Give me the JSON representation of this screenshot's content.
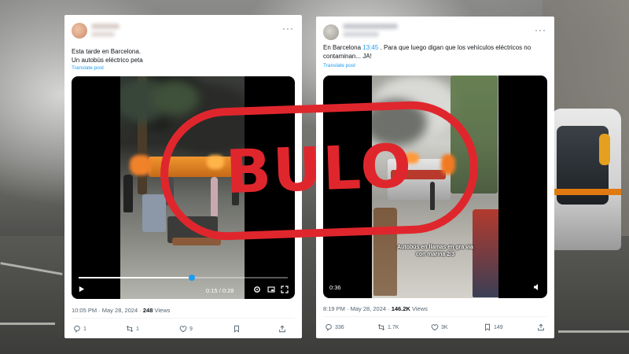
{
  "posts": [
    {
      "text": "Esta tarde en Barcelona.\nUn autobús eléctrico peta",
      "translate_label": "Translate post",
      "video": {
        "elapsed": "0:15",
        "duration": "0:28",
        "progress": 0.54
      },
      "timestamp": "10:05 PM · May 28, 2024 · ",
      "views_count": "248",
      "views_label": " Views",
      "actions": {
        "replies": "1",
        "reposts": "1",
        "likes": "9"
      }
    },
    {
      "text_before": "En Barcelona ",
      "text_highlight": "13:45",
      "text_after": " . Para que luego digan que los vehículos eléctricos no contaminan... JA!",
      "translate_label": "Translate post",
      "video": {
        "remaining": "0:36",
        "caption": "Autobús en llamas en gra via\ncon marina 2/3"
      },
      "timestamp": "8:19 PM · May 28, 2024 · ",
      "views_count": "146.2K",
      "views_label": " Views",
      "actions": {
        "replies": "336",
        "reposts": "1.7K",
        "likes": "3K",
        "bookmarks": "149"
      }
    }
  ],
  "stamp": {
    "text": "BULO",
    "color": "#e0262d"
  },
  "colors": {
    "link": "#1d9bf0",
    "muted": "#536471",
    "text": "#0f1419"
  },
  "icons": [
    "more-icon",
    "play-icon",
    "settings-icon",
    "fullscreen-icon",
    "pip-icon",
    "reply-icon",
    "repost-icon",
    "like-icon",
    "bookmark-icon",
    "share-icon",
    "volume-icon"
  ]
}
